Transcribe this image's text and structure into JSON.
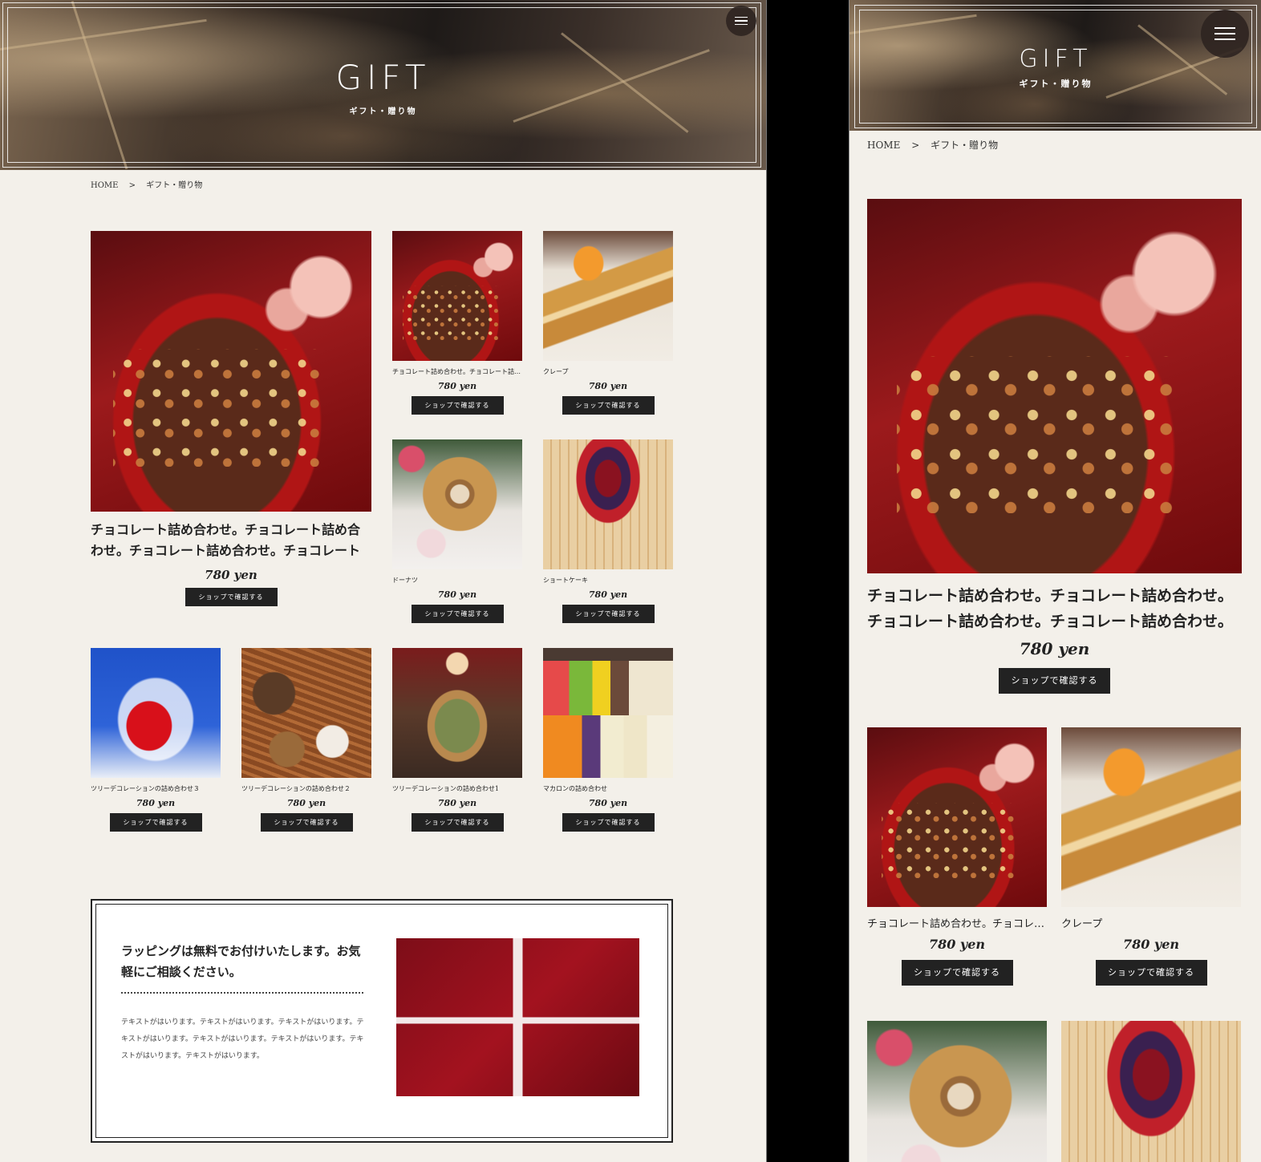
{
  "hero": {
    "title": "GIFT",
    "subtitle": "ギフト・贈り物"
  },
  "breadcrumb": {
    "home": "HOME",
    "separator": ">",
    "current": "ギフト・贈り物"
  },
  "products": {
    "featured": {
      "name": "チョコレート詰め合わせ。チョコレート詰め合わせ。チョコレート詰め合わせ。チョコレート詰め合わせ。",
      "price": "780 yen",
      "button": "ショップで確認する"
    },
    "items": [
      {
        "name": "チョコレート詰め合わせ。チョコレート詰め合わせ。",
        "price": "780 yen",
        "button": "ショップで確認する"
      },
      {
        "name": "クレープ",
        "price": "780 yen",
        "button": "ショップで確認する"
      },
      {
        "name": "ドーナツ",
        "price": "780 yen",
        "button": "ショップで確認する"
      },
      {
        "name": "ショートケーキ",
        "price": "780 yen",
        "button": "ショップで確認する"
      },
      {
        "name": "ツリーデコレーションの詰め合わせ３",
        "price": "780 yen",
        "button": "ショップで確認する"
      },
      {
        "name": "ツリーデコレーションの詰め合わせ２",
        "price": "780 yen",
        "button": "ショップで確認する"
      },
      {
        "name": "ツリーデコレーションの詰め合わせ1",
        "price": "780 yen",
        "button": "ショップで確認する"
      },
      {
        "name": "マカロンの詰め合わせ",
        "price": "780 yen",
        "button": "ショップで確認する"
      }
    ]
  },
  "info": {
    "heading": "ラッピングは無料でお付けいたします。お気軽にご相談ください。",
    "body": "テキストがはいります。テキストがはいります。テキストがはいります。テキストがはいります。テキストがはいります。テキストがはいります。テキストがはいります。テキストがはいります。"
  },
  "icons": {
    "menu": "hamburger-menu-icon"
  }
}
